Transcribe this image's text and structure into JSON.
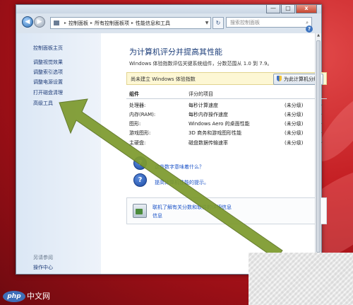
{
  "window": {
    "controls": {
      "minimize": "—",
      "maximize": "□",
      "close": "x"
    }
  },
  "nav": {
    "back": "◀",
    "forward": "▶",
    "breadcrumb": [
      "控制面板",
      "所有控制面板项",
      "性能信息和工具"
    ],
    "refresh": "↻",
    "search_placeholder": "搜索控制面板",
    "help": "?"
  },
  "sidebar": {
    "items": [
      {
        "label": "控制面板主页"
      },
      {
        "label": "调整视觉效果"
      },
      {
        "label": "调整索引选项"
      },
      {
        "label": "调整电源设置"
      },
      {
        "label": "打开磁盘清理"
      },
      {
        "label": "高级工具"
      }
    ],
    "see_also": "另请参阅",
    "action_center": "操作中心"
  },
  "main": {
    "title": "为计算机评分并提高其性能",
    "subtitle": "Windows 体验指数评估关键系统组件，分数范围从 1.0 到 7.9。",
    "notice": "尚未建立 Windows 体验指数",
    "rate_button": "为此计算机分级",
    "table": {
      "headers": [
        "组件",
        "评分的项目"
      ],
      "rows": [
        {
          "component": "处理器:",
          "item": "每秒计算速度",
          "score": "(未分级)"
        },
        {
          "component": "内存(RAM):",
          "item": "每秒内存操作速度",
          "score": "(未分级)"
        },
        {
          "component": "图形:",
          "item": "Windows Aero 的桌面性能",
          "score": "(未分级)"
        },
        {
          "component": "游戏图形:",
          "item": "3D 商务和游戏图形性能",
          "score": "(未分级)"
        },
        {
          "component": "主硬盘:",
          "item": "磁盘数据传输速率",
          "score": "(未分级)"
        }
      ]
    },
    "links": {
      "what_means": "这些数字意味着什么？",
      "tips": "提高计算机性能的提示。"
    },
    "info_link1": "联机了解有关分数和软件的详细信息",
    "info_link2": "信息"
  },
  "watermark": {
    "logo": "php",
    "text": "中文网"
  },
  "colors": {
    "arrow": "#7d9a2e",
    "link": "#1a52c7",
    "desktop": "#c31d22"
  }
}
